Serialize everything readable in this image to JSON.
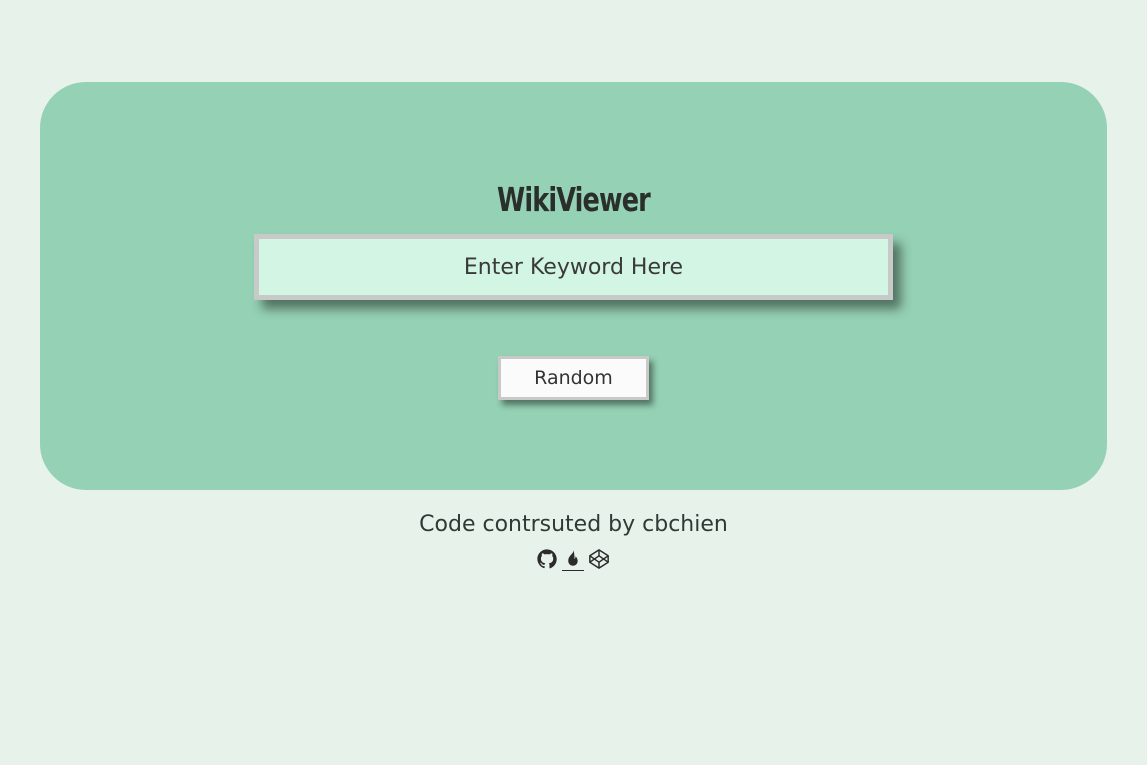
{
  "header": {
    "title": "WikiViewer"
  },
  "search": {
    "placeholder": "Enter Keyword Here",
    "value": ""
  },
  "actions": {
    "random_label": "Random"
  },
  "footer": {
    "credit": "Code contrsuted by cbchien",
    "icons": [
      "github-icon",
      "freecodecamp-icon",
      "codepen-icon"
    ]
  },
  "colors": {
    "background": "#e7f2ea",
    "card": "#95d1b4",
    "search_bg": "#d2f5e4",
    "button_bg": "#fbfbfb"
  }
}
